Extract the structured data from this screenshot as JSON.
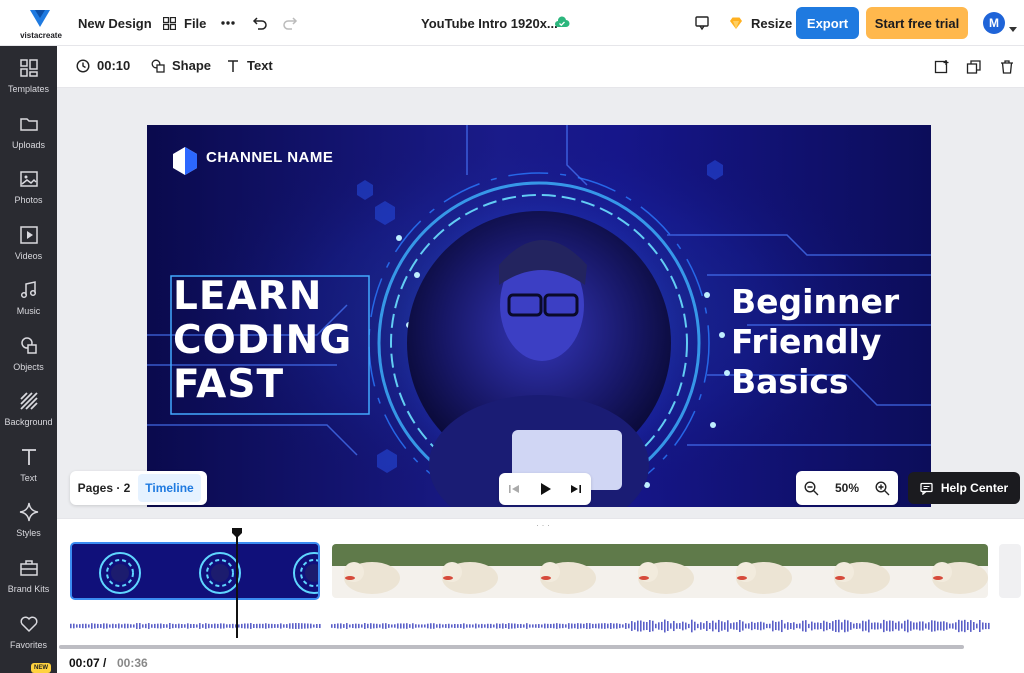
{
  "topbar": {
    "logo_text": "vistacreate",
    "doc_name": "New Design",
    "file_label": "File",
    "title": "YouTube Intro 1920x...",
    "resize_label": "Resize",
    "export_label": "Export",
    "trial_label": "Start free trial",
    "avatar_initial": "M"
  },
  "sidebar": {
    "items": [
      {
        "label": "Templates",
        "icon": "templates-icon"
      },
      {
        "label": "Uploads",
        "icon": "folder-icon"
      },
      {
        "label": "Photos",
        "icon": "image-icon"
      },
      {
        "label": "Videos",
        "icon": "video-icon"
      },
      {
        "label": "Music",
        "icon": "music-icon"
      },
      {
        "label": "Objects",
        "icon": "shapes-icon"
      },
      {
        "label": "Background",
        "icon": "background-icon"
      },
      {
        "label": "Text",
        "icon": "text-icon"
      },
      {
        "label": "Styles",
        "icon": "sparkle-icon"
      },
      {
        "label": "Brand Kits",
        "icon": "briefcase-icon"
      },
      {
        "label": "Favorites",
        "icon": "heart-icon"
      }
    ],
    "new_badge": "NEW"
  },
  "toolbar": {
    "duration": "00:10",
    "shape_label": "Shape",
    "text_label": "Text"
  },
  "canvas": {
    "channel_name": "CHANNEL NAME",
    "headline_lines": [
      "LEARN",
      "CODING",
      "FAST"
    ],
    "side_lines": [
      "Beginner",
      "Friendly",
      "Basics"
    ]
  },
  "controls": {
    "pages_label": "Pages · 2",
    "timeline_label": "Timeline",
    "zoom": "50%",
    "help_label": "Help Center"
  },
  "timeline": {
    "current_time": "00:07 /",
    "total_time": "00:36",
    "handle": "· · ·"
  },
  "colors": {
    "accent": "#1f7ae0",
    "trial": "#ffb84d",
    "sidebar": "#2a2b31",
    "canvas_bg": "#12127a"
  }
}
